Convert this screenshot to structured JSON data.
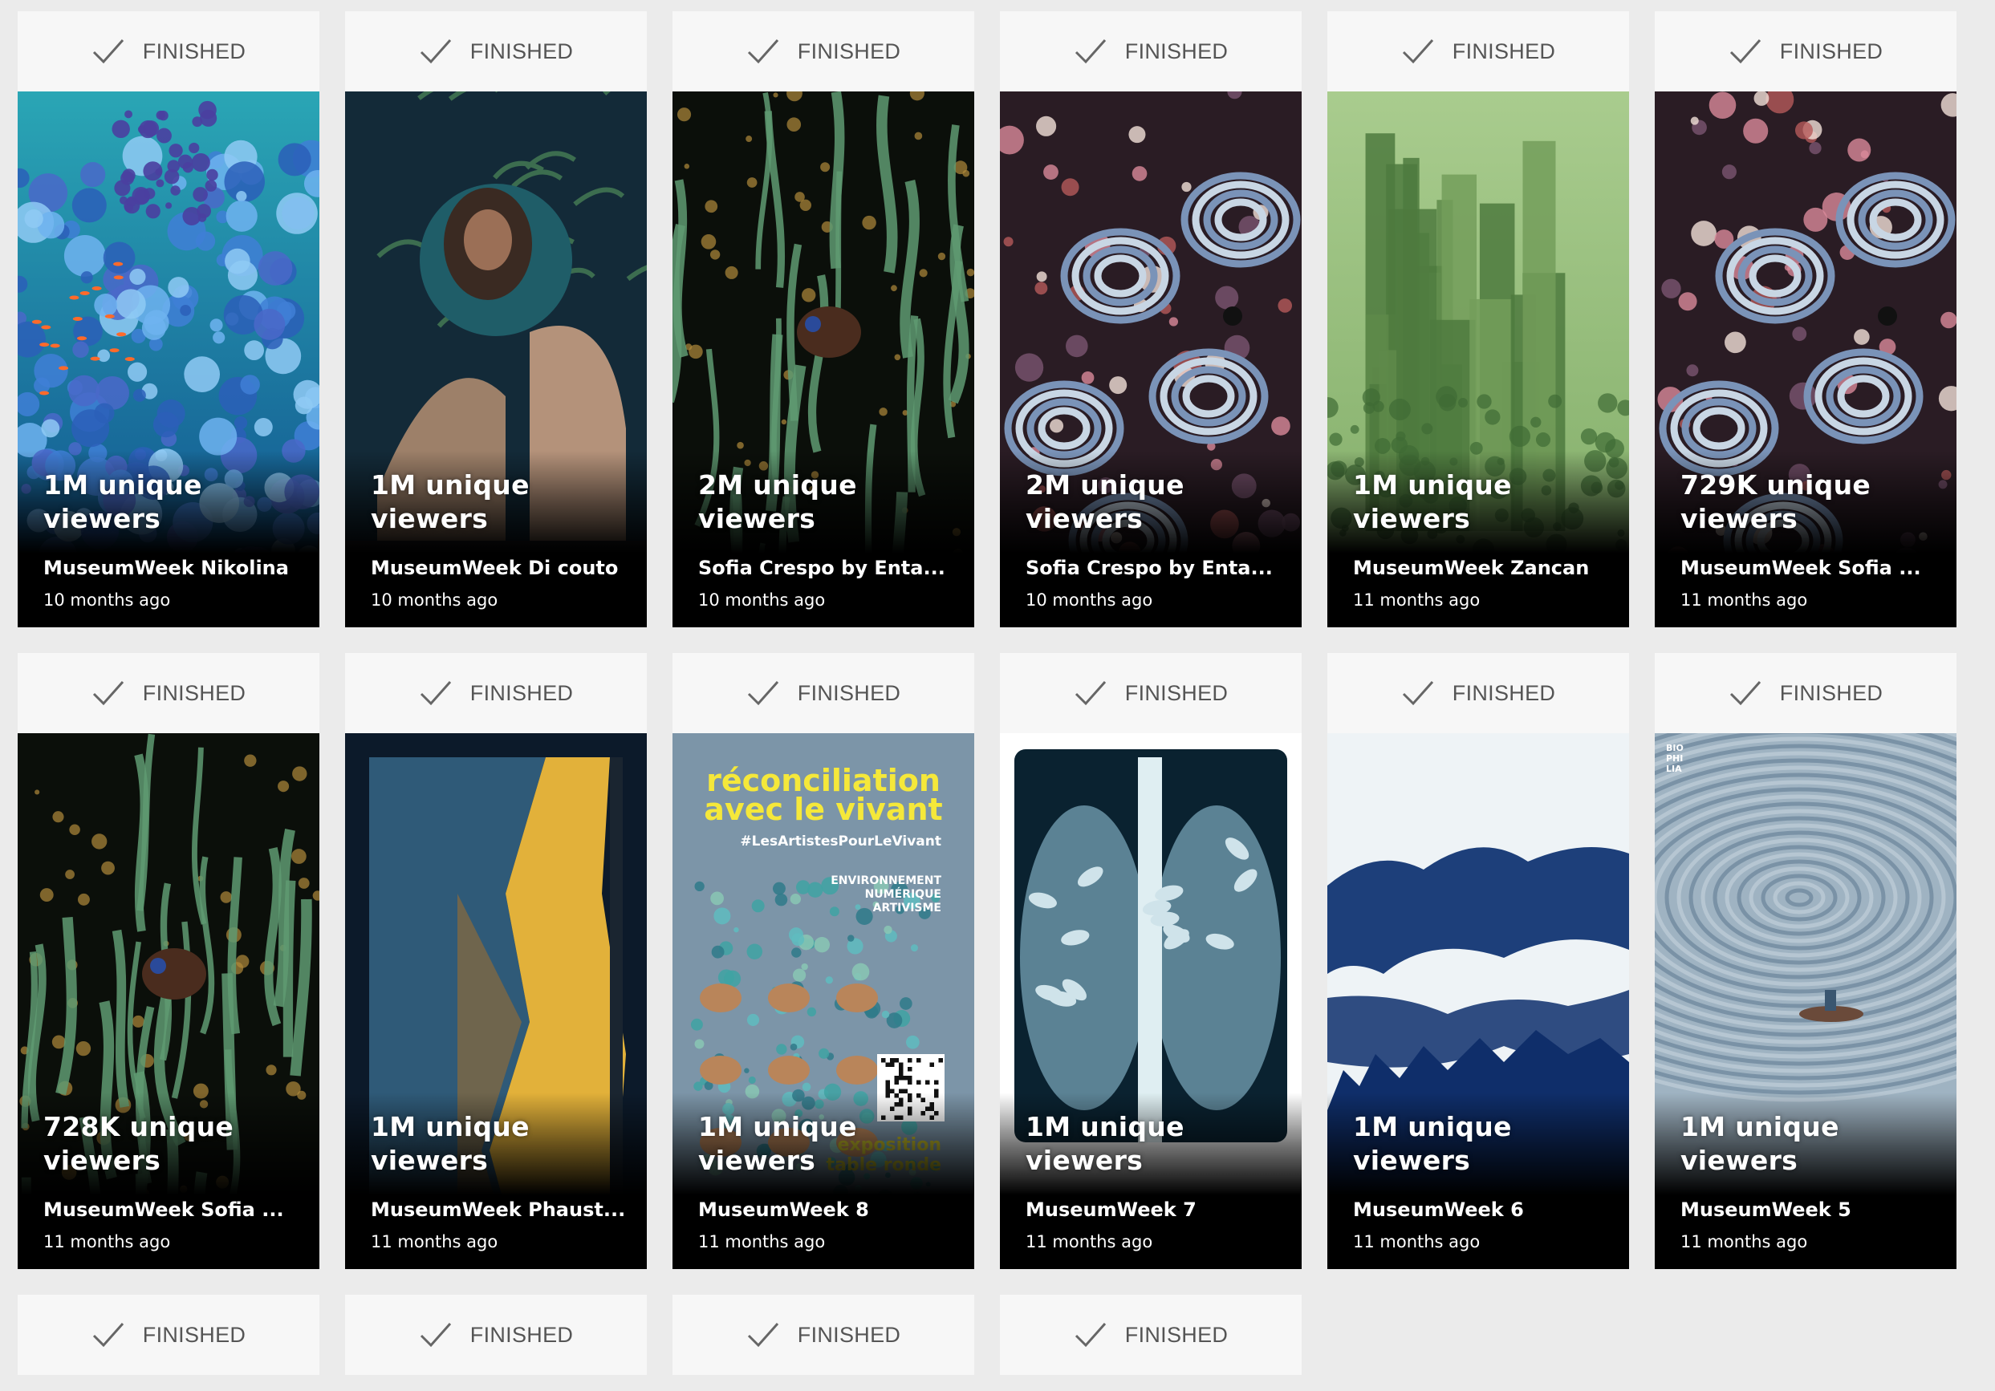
{
  "status_label": "FINISHED",
  "cards": [
    {
      "viewers": "1M unique viewers",
      "title": "MuseumWeek Nikolina",
      "age": "10 months ago",
      "art": "coral"
    },
    {
      "viewers": "1M unique viewers",
      "title": "MuseumWeek Di couto",
      "age": "10 months ago",
      "art": "wolves"
    },
    {
      "viewers": "2M unique viewers",
      "title": "Sofia Crespo by Enta...",
      "age": "10 months ago",
      "art": "tentacles"
    },
    {
      "viewers": "2M unique viewers",
      "title": "Sofia Crespo by Enta...",
      "age": "10 months ago",
      "art": "organic"
    },
    {
      "viewers": "1M unique viewers",
      "title": "MuseumWeek Zancan",
      "age": "11 months ago",
      "art": "green-city"
    },
    {
      "viewers": "729K unique viewers",
      "title": "MuseumWeek Sofia ...",
      "age": "11 months ago",
      "art": "organic"
    },
    {
      "viewers": "728K unique viewers",
      "title": "MuseumWeek Sofia ...",
      "age": "11 months ago",
      "art": "tentacles"
    },
    {
      "viewers": "1M unique viewers",
      "title": "MuseumWeek Phaust...",
      "age": "11 months ago",
      "art": "landscape-band"
    },
    {
      "viewers": "1M unique viewers",
      "title": "MuseumWeek 8",
      "age": "11 months ago",
      "art": "poster",
      "poster": {
        "headline_1": "réconciliation",
        "headline_2": "avec le vivant",
        "hashtag": "#LesArtistesPourLeVivant",
        "tags": [
          "ENVIRONNEMENT",
          "NUMÉRIQUE",
          "ARTIVISME"
        ],
        "footer_1": "exposition",
        "footer_2": "table ronde"
      }
    },
    {
      "viewers": "1M unique viewers",
      "title": "MuseumWeek 7",
      "age": "11 months ago",
      "art": "xray"
    },
    {
      "viewers": "1M unique viewers",
      "title": "MuseumWeek 6",
      "age": "11 months ago",
      "art": "ink-mountains"
    },
    {
      "viewers": "1M unique viewers",
      "title": "MuseumWeek 5",
      "age": "11 months ago",
      "art": "rings",
      "corner_mark": [
        "BIO",
        "PHI",
        "LIA"
      ]
    },
    {
      "partial": true
    },
    {
      "partial": true
    },
    {
      "partial": true
    },
    {
      "partial": true
    }
  ]
}
